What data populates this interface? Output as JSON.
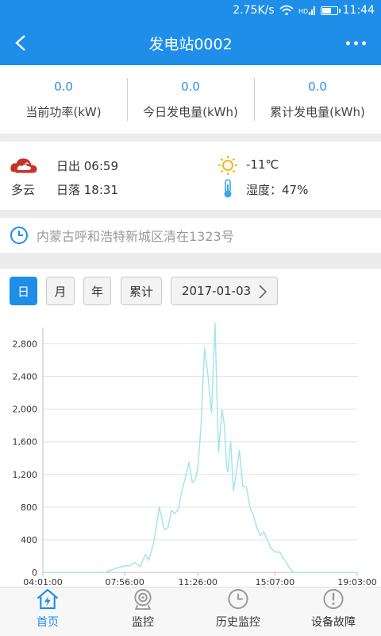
{
  "status_bar": {
    "speed": "2.75K/s",
    "time": "11:44",
    "battery_level": 0.65
  },
  "header": {
    "title": "发电站0002"
  },
  "stats": [
    {
      "value": "0.0",
      "label": "当前功率(kW)"
    },
    {
      "value": "0.0",
      "label": "今日发电量(kWh)"
    },
    {
      "value": "0.0",
      "label": "累计发电量(kWh)"
    }
  ],
  "weather": {
    "condition": "多云",
    "sunrise": "日出 06:59",
    "sunset": "日落 18:31",
    "temperature": "-11℃",
    "humidity": "湿度：47%"
  },
  "address": {
    "text": "内蒙古呼和浩特新城区清在1323号"
  },
  "period": {
    "buttons": [
      "日",
      "月",
      "年",
      "累计"
    ],
    "active": "日",
    "date": "2017-01-03"
  },
  "colors": {
    "primary": "#1e8ee9",
    "line": "#a6e3ec"
  },
  "chart_data": {
    "type": "line",
    "x_labels": [
      "04:01:00",
      "07:56:00",
      "11:26:00",
      "15:07:00",
      "19:03:00"
    ],
    "y_ticks": [
      "0",
      "400",
      "800",
      "1,200",
      "1,600",
      "2,000",
      "2,400",
      "2,800"
    ],
    "ylim": [
      0,
      3000
    ],
    "xlim": [
      "04:01",
      "19:03"
    ],
    "grid": true,
    "x": [
      "04:01",
      "07:00",
      "07:30",
      "07:56",
      "08:10",
      "08:25",
      "08:40",
      "08:55",
      "09:05",
      "09:20",
      "09:35",
      "09:50",
      "10:00",
      "10:10",
      "10:20",
      "10:30",
      "10:40",
      "10:55",
      "11:00",
      "11:10",
      "11:20",
      "11:26",
      "11:35",
      "11:45",
      "11:55",
      "12:05",
      "12:15",
      "12:25",
      "12:35",
      "12:42",
      "12:48",
      "12:52",
      "13:00",
      "13:08",
      "13:15",
      "13:25",
      "13:35",
      "13:45",
      "13:55",
      "14:05",
      "14:15",
      "14:25",
      "14:35",
      "14:45",
      "14:55",
      "15:07",
      "15:20",
      "15:35",
      "15:50",
      "16:00",
      "16:15",
      "16:30",
      "16:45",
      "17:00",
      "17:15",
      "19:03"
    ],
    "y": [
      0,
      0,
      50,
      80,
      80,
      120,
      70,
      220,
      150,
      380,
      800,
      520,
      550,
      760,
      720,
      780,
      1000,
      1250,
      1350,
      1100,
      1150,
      1300,
      1800,
      2750,
      2400,
      1950,
      3050,
      1470,
      2000,
      1800,
      1300,
      1230,
      1600,
      1000,
      1180,
      1500,
      1050,
      1050,
      800,
      700,
      550,
      450,
      500,
      400,
      300,
      250,
      250,
      150,
      50,
      0,
      0,
      0,
      0,
      0,
      0,
      0
    ]
  },
  "tabs": [
    {
      "label": "首页",
      "icon": "home-bolt-icon"
    },
    {
      "label": "监控",
      "icon": "camera-icon"
    },
    {
      "label": "历史监控",
      "icon": "clock-icon"
    },
    {
      "label": "设备故障",
      "icon": "alert-icon"
    }
  ],
  "active_tab": 0
}
